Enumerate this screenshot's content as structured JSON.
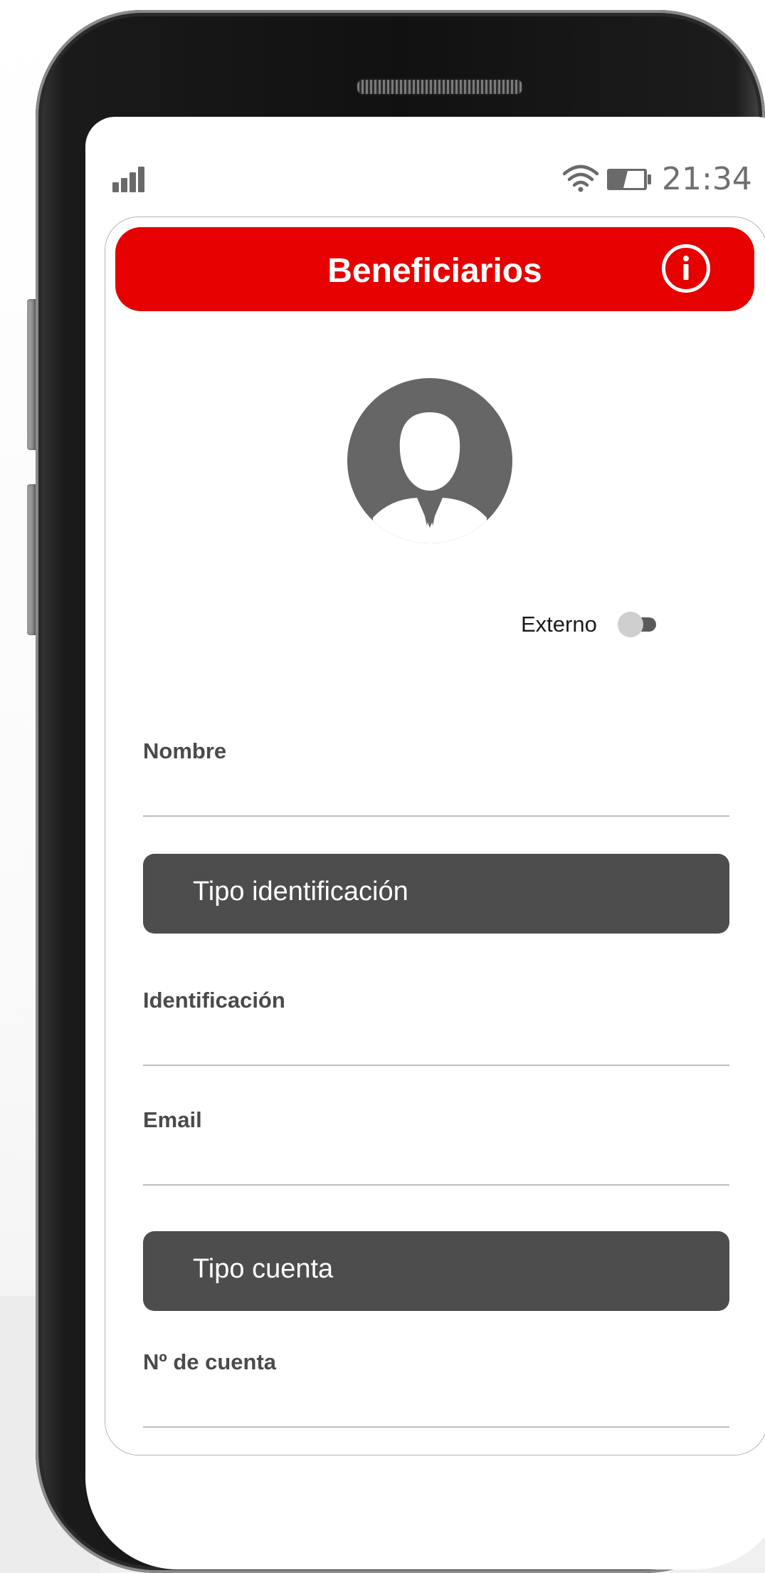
{
  "status_bar": {
    "time": "21:34",
    "signal_icon": "signal-bars-icon",
    "wifi_icon": "wifi-icon",
    "battery_icon": "battery-icon"
  },
  "header": {
    "title": "Beneficiarios",
    "info_icon": "info-icon",
    "color": "#e60000"
  },
  "avatar": {
    "icon": "user-avatar-icon"
  },
  "external_toggle": {
    "label": "Externo",
    "on": false
  },
  "form": {
    "name_label": "Nombre",
    "id_type_select": "Tipo identificación",
    "id_label": "Identificación",
    "email_label": "Email",
    "account_type_select": "Tipo cuenta",
    "account_number_label": "Nº de cuenta"
  },
  "colors": {
    "accent": "#e60000",
    "select_bg": "#4d4d4d",
    "label": "#4a4a4a"
  }
}
